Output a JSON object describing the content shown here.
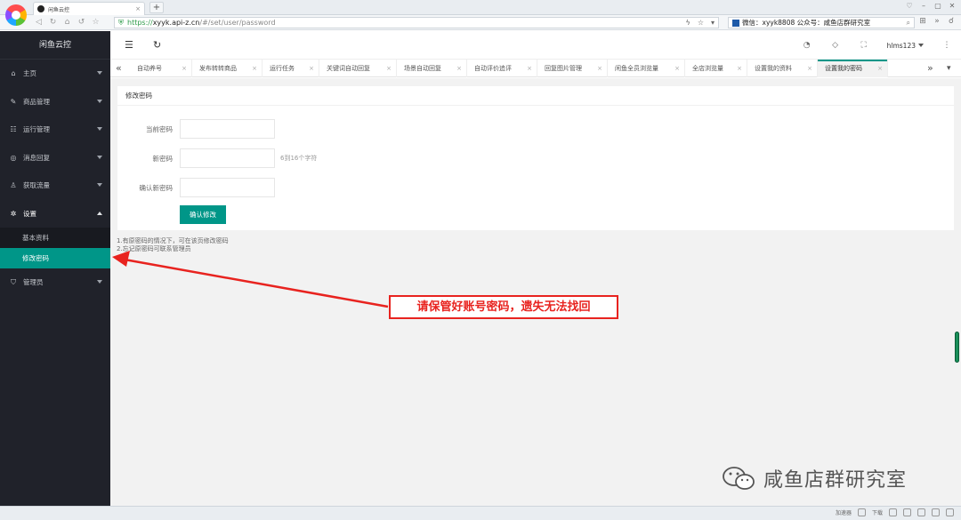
{
  "browser": {
    "tab_title": "闲鱼云控",
    "tab_close": "×",
    "new_tab": "+",
    "url_scheme": "https://",
    "url_host": "xyyk.api-z.cn",
    "url_path": "/#/set/user/password",
    "search_text": "微信：xyyk8808  公众号：咸鱼店群研究室",
    "status_items": [
      "加速器",
      "下载"
    ]
  },
  "sidebar": {
    "brand": "闲鱼云控",
    "items": [
      {
        "label": "主页",
        "icon": "home-icon",
        "glyph": "⌂"
      },
      {
        "label": "商品管理",
        "icon": "edit-icon",
        "glyph": "✎"
      },
      {
        "label": "运行管理",
        "icon": "task-icon",
        "glyph": "☷"
      },
      {
        "label": "消息回复",
        "icon": "message-icon",
        "glyph": "◎"
      },
      {
        "label": "获取流量",
        "icon": "user-icon",
        "glyph": "♙"
      },
      {
        "label": "设置",
        "icon": "settings-icon",
        "glyph": "✲"
      }
    ],
    "sub_items": [
      {
        "label": "基本资料"
      },
      {
        "label": "修改密码"
      }
    ],
    "admin": {
      "label": "管理员",
      "icon": "shield-icon",
      "glyph": "⛉"
    }
  },
  "header": {
    "username": "hlms123"
  },
  "page_tabs": [
    {
      "label": "自动养号",
      "width": 70
    },
    {
      "label": "发布转转商品",
      "width": 79
    },
    {
      "label": "运行任务",
      "width": 64
    },
    {
      "label": "关键词自动回复",
      "width": 87
    },
    {
      "label": "场景自动回复",
      "width": 79
    },
    {
      "label": "自动评价追评",
      "width": 79
    },
    {
      "label": "回复图片管理",
      "width": 79
    },
    {
      "label": "闲鱼全员浏览量",
      "width": 87
    },
    {
      "label": "全店浏览量",
      "width": 70
    },
    {
      "label": "设置我的资料",
      "width": 79
    },
    {
      "label": "设置我的密码",
      "width": 79,
      "active": true
    }
  ],
  "form": {
    "title": "修改密码",
    "current_label": "当前密码",
    "new_label": "新密码",
    "new_hint": "6到16个字符",
    "confirm_label": "确认新密码",
    "submit_label": "确认修改"
  },
  "notes": [
    "1.有原密码的情况下，可在该页修改密码",
    "2.忘记原密码可联系管理员"
  ],
  "annotation": {
    "text": "请保管好账号密码，遗失无法找回",
    "color": "#e8231f"
  },
  "watermark": {
    "text": "咸鱼店群研究室"
  },
  "colors": {
    "accent": "#009688",
    "sidebar_bg": "#20222a"
  }
}
